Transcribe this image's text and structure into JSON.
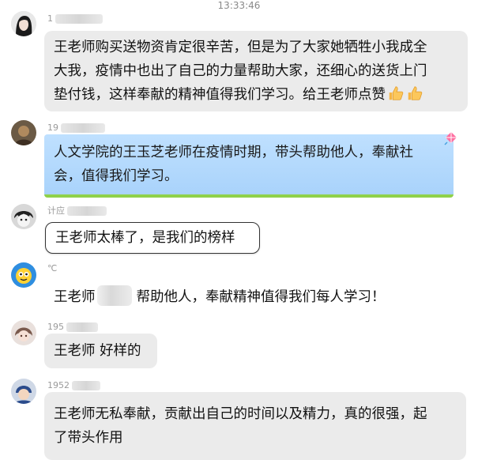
{
  "timestamp": "13:33:46",
  "messages": [
    {
      "name_visible": "1",
      "text": "王老师购买送物资肯定很辛苦，但是为了大家她牺牲小我成全大我，疫情中也出了自己的力量帮助大家，还细心的送货上门垫付钱，这样奉献的精神值得我们学习。给王老师点赞",
      "lines": [
        "王老师购买送物资肯定很辛苦，但是为了大家她牺牲小我成全",
        "大我，疫情中也出了自己的力量帮助大家，还细心的送货上门",
        "垫付钱，这样奉献的精神值得我们学习。给王老师点赞"
      ],
      "emoji": "thumbs-up",
      "style": "gray"
    },
    {
      "name_visible": "19",
      "text": "人文学院的王玉芝老师在疫情时期，带头帮助他人，奉献社会，值得我们学习。",
      "lines": [
        "人文学院的王玉芝老师在疫情时期，带头帮助他人，奉献社",
        "会，值得我们学习。"
      ],
      "style": "blue-kite"
    },
    {
      "name_visible": "计应",
      "text": "王老师太棒了，是我们的榜样",
      "style": "framed"
    },
    {
      "name_visible": "℃",
      "text_before": "王老师",
      "text_after": "帮助他人，奉献精神值得我们每人学习！",
      "style": "plain"
    },
    {
      "name_visible": "195",
      "text": "王老师 好样的",
      "style": "gray"
    },
    {
      "name_visible": "1952",
      "text": "王老师无私奉献，贡献出自己的时间以及精力，真的很强，起了带头作用",
      "lines": [
        "王老师无私奉献，贡献出自己的时间以及精力，真的很强，起",
        "了带头作用"
      ],
      "style": "gray"
    }
  ],
  "colors": {
    "bubble_gray": "#ebebeb",
    "bubble_blue": "#bfe0ff",
    "blue_border": "#8fd14a",
    "name_gray": "#9a9a9a"
  }
}
